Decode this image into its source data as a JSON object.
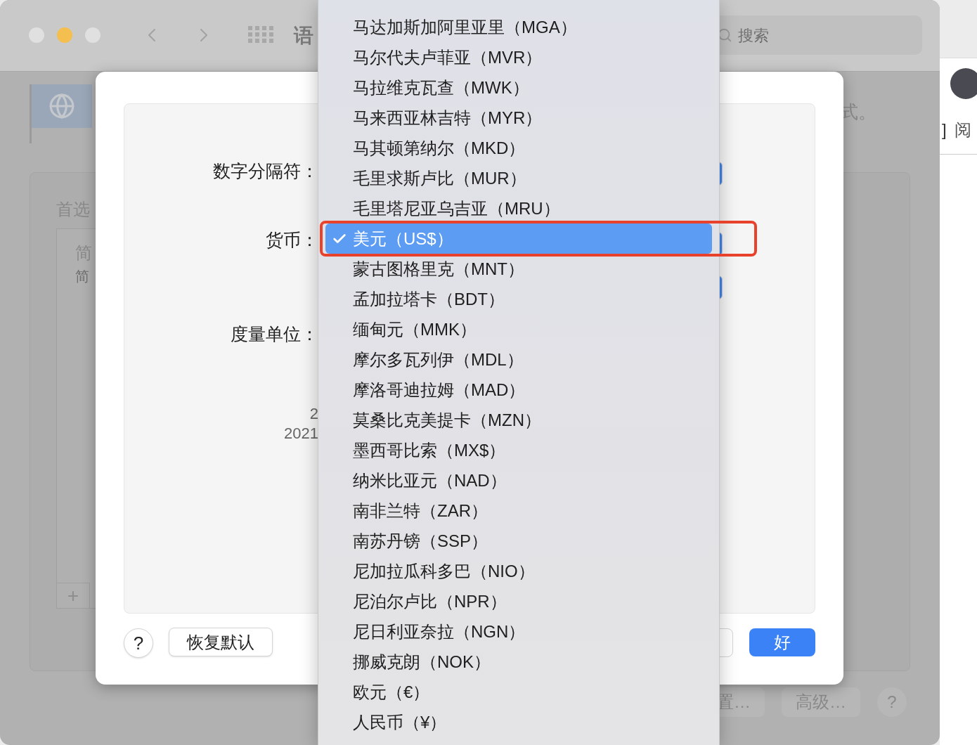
{
  "window": {
    "title": "语",
    "search": {
      "placeholder": "搜索"
    }
  },
  "background_pane": {
    "heading": "首选",
    "list_items": [
      {
        "title": "简",
        "subtitle": "简"
      }
    ],
    "add": "+",
    "description": "式。",
    "buttons": [
      "置…",
      "高级…",
      "?"
    ]
  },
  "side_page": {
    "bracket": "]",
    "text": "阅"
  },
  "dialog": {
    "rows": [
      {
        "label": "数字分隔符："
      },
      {
        "label": "货币："
      },
      {
        "label": "度量单位："
      }
    ],
    "sample": [
      "2",
      "2021"
    ],
    "help": "?",
    "reset": "恢复默认",
    "ok": "好"
  },
  "currency_menu": {
    "items": [
      {
        "label": "马达加斯加阿里亚里（MGA）",
        "selected": false
      },
      {
        "label": "马尔代夫卢菲亚（MVR）",
        "selected": false
      },
      {
        "label": "马拉维克瓦查（MWK）",
        "selected": false
      },
      {
        "label": "马来西亚林吉特（MYR）",
        "selected": false
      },
      {
        "label": "马其顿第纳尔（MKD）",
        "selected": false
      },
      {
        "label": "毛里求斯卢比（MUR）",
        "selected": false
      },
      {
        "label": "毛里塔尼亚乌吉亚（MRU）",
        "selected": false
      },
      {
        "label": "美元（US$）",
        "selected": true
      },
      {
        "label": "蒙古图格里克（MNT）",
        "selected": false
      },
      {
        "label": "孟加拉塔卡（BDT）",
        "selected": false
      },
      {
        "label": "缅甸元（MMK）",
        "selected": false
      },
      {
        "label": "摩尔多瓦列伊（MDL）",
        "selected": false
      },
      {
        "label": "摩洛哥迪拉姆（MAD）",
        "selected": false
      },
      {
        "label": "莫桑比克美提卡（MZN）",
        "selected": false
      },
      {
        "label": "墨西哥比索（MX$）",
        "selected": false
      },
      {
        "label": "纳米比亚元（NAD）",
        "selected": false
      },
      {
        "label": "南非兰特（ZAR）",
        "selected": false
      },
      {
        "label": "南苏丹镑（SSP）",
        "selected": false
      },
      {
        "label": "尼加拉瓜科多巴（NIO）",
        "selected": false
      },
      {
        "label": "尼泊尔卢比（NPR）",
        "selected": false
      },
      {
        "label": "尼日利亚奈拉（NGN）",
        "selected": false
      },
      {
        "label": "挪威克朗（NOK）",
        "selected": false
      },
      {
        "label": "欧元（€）",
        "selected": false
      },
      {
        "label": "人民币（¥）",
        "selected": false
      }
    ]
  }
}
